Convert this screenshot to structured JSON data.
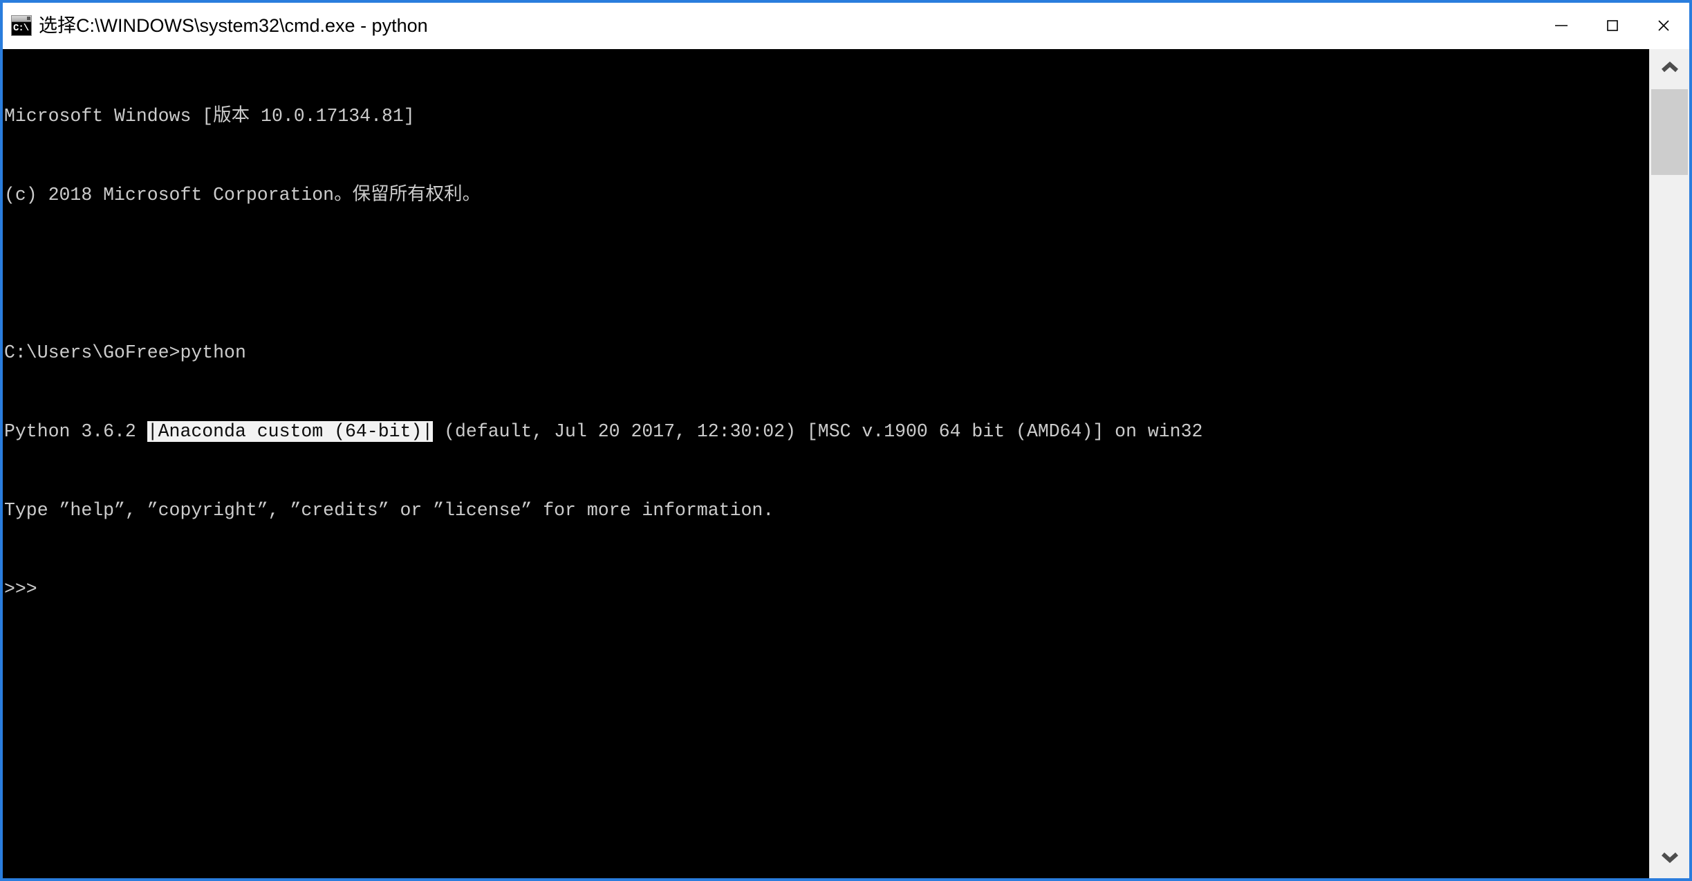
{
  "window": {
    "title": "选择C:\\WINDOWS\\system32\\cmd.exe - python",
    "icon_label": "C:\\",
    "border_color": "#2a7ddd",
    "titlebar_bg": "#ffffff",
    "console_bg": "#000000",
    "console_fg": "#cccccc",
    "selection_bg": "#f2f2f2",
    "selection_fg": "#0c0c0c",
    "controls": {
      "minimize": "minimize",
      "maximize": "maximize",
      "close": "close"
    }
  },
  "console": {
    "lines": [
      {
        "text": "Microsoft Windows [版本 10.0.17134.81]"
      },
      {
        "text": "(c) 2018 Microsoft Corporation。保留所有权利。"
      },
      {
        "text": ""
      },
      {
        "text": "C:\\Users\\GoFree>python"
      }
    ],
    "version_line": {
      "prefix": "Python 3.6.2 ",
      "selected": "|Anaconda custom (64-bit)|",
      "suffix": " (default, Jul 20 2017, 12:30:02) [MSC v.1900 64 bit (AMD64)] on win32"
    },
    "help_line": "Type ”help”, ”copyright”, ”credits” or ”license” for more information.",
    "prompt": ">>>"
  },
  "scrollbar": {
    "up_arrow": "chevron-up-icon",
    "down_arrow": "chevron-down-icon",
    "thumb_position_percent": 0,
    "thumb_size_percent": 11
  }
}
